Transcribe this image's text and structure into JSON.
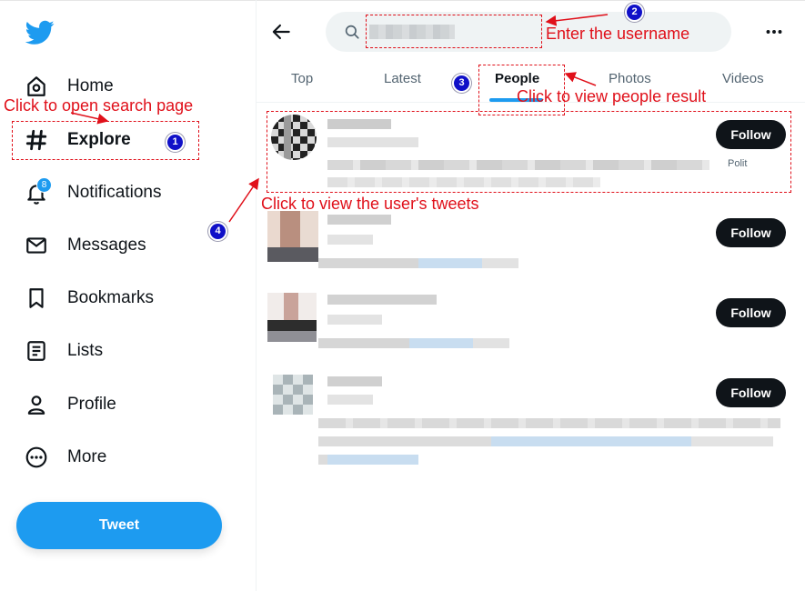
{
  "sidebar": {
    "logo_icon": "twitter-bird-icon",
    "items": [
      {
        "label": "Home",
        "icon": "home-icon"
      },
      {
        "label": "Explore",
        "icon": "hashtag-icon"
      },
      {
        "label": "Notifications",
        "icon": "bell-icon",
        "badge": "8"
      },
      {
        "label": "Messages",
        "icon": "envelope-icon"
      },
      {
        "label": "Bookmarks",
        "icon": "bookmark-icon"
      },
      {
        "label": "Lists",
        "icon": "list-icon"
      },
      {
        "label": "Profile",
        "icon": "user-icon"
      },
      {
        "label": "More",
        "icon": "more-circle-icon"
      }
    ],
    "tweet_label": "Tweet"
  },
  "header": {
    "back_icon": "arrow-left-icon",
    "search_icon": "search-icon",
    "more_icon": "ellipsis-icon"
  },
  "tabs": [
    {
      "label": "Top"
    },
    {
      "label": "Latest"
    },
    {
      "label": "People"
    },
    {
      "label": "Photos"
    },
    {
      "label": "Videos"
    }
  ],
  "results": [
    {
      "follow_label": "Follow",
      "bio_fragment": "Polit"
    },
    {
      "follow_label": "Follow"
    },
    {
      "follow_label": "Follow"
    },
    {
      "follow_label": "Follow"
    }
  ],
  "annotations": [
    {
      "number": "1",
      "text": "Click to open search page"
    },
    {
      "number": "2",
      "text": "Enter the username"
    },
    {
      "number": "3",
      "text": "Click to view people result"
    },
    {
      "number": "4",
      "text": "Click to view the user's tweets"
    }
  ],
  "colors": {
    "accent": "#1d9bf0",
    "annotation": "#e0101a",
    "marker": "#1010c8",
    "follow_button": "#0f1419"
  }
}
